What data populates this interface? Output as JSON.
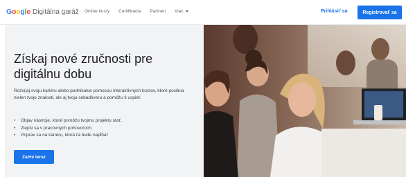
{
  "header": {
    "logo_letters": [
      "G",
      "o",
      "o",
      "g",
      "l",
      "e"
    ],
    "logo_rest": "Digitálna garáž",
    "nav": [
      {
        "label": "Online kurzy"
      },
      {
        "label": "Certifikácia"
      },
      {
        "label": "Partneri"
      },
      {
        "label": "Viac",
        "has_dropdown": true
      }
    ],
    "login_label": "Prihlásiť sa",
    "register_label": "Registrovať sa"
  },
  "hero": {
    "headline": "Získaj nové zručnosti pre digitálnu dobu",
    "intro": "Rozvíjaj svoju kariéru alebo podnikanie pomocou interaktívnych kurzov, ktoré posilnia nielen tvoje znalosti, ale aj tvoju sebadôveru a pomôžu ti uspieť.",
    "bullets": [
      "Objav nástroje, ktoré pomôžu tvojmu projektu rásť.",
      "Zlepši sa v pracovných pohovoroch.",
      "Priprav sa na kariéru, ktorá ťa bude napĺňať"
    ],
    "cta_label": "Začni teraz"
  },
  "colors": {
    "accent": "#1a73e8",
    "panel_bg": "#f1f3f4"
  },
  "icons": {
    "nav_dropdown": "chevron-down-icon"
  }
}
